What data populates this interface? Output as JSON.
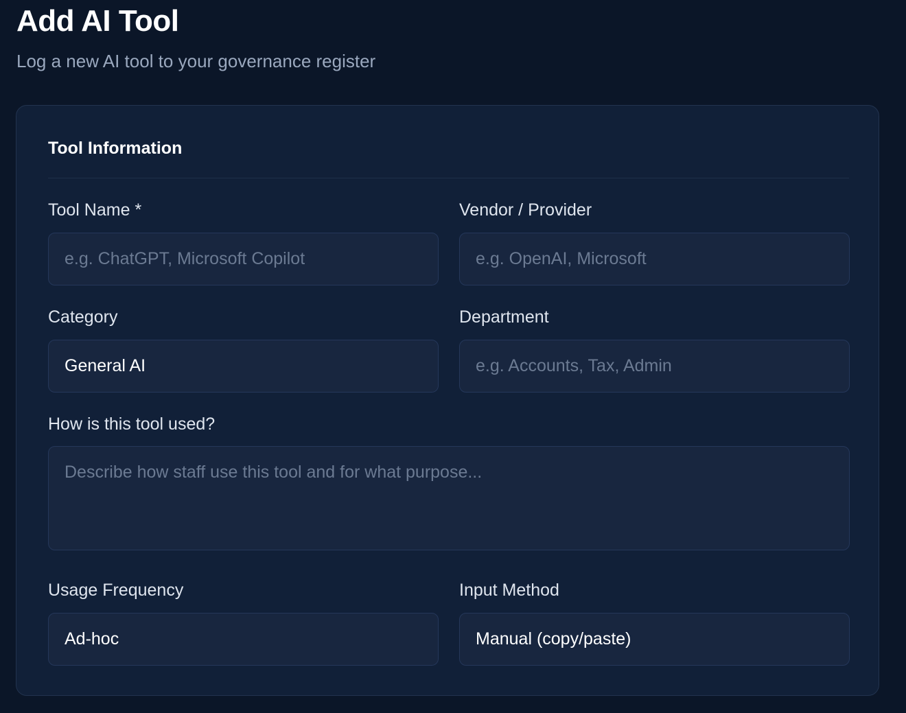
{
  "page": {
    "title": "Add AI Tool",
    "subtitle": "Log a new AI tool to your governance register"
  },
  "form": {
    "section_title": "Tool Information",
    "tool_name": {
      "label": "Tool Name *",
      "value": "",
      "placeholder": "e.g. ChatGPT, Microsoft Copilot"
    },
    "vendor": {
      "label": "Vendor / Provider",
      "value": "",
      "placeholder": "e.g. OpenAI, Microsoft"
    },
    "category": {
      "label": "Category",
      "value": "General AI"
    },
    "department": {
      "label": "Department",
      "value": "",
      "placeholder": "e.g. Accounts, Tax, Admin"
    },
    "usage_description": {
      "label": "How is this tool used?",
      "value": "",
      "placeholder": "Describe how staff use this tool and for what purpose..."
    },
    "usage_frequency": {
      "label": "Usage Frequency",
      "value": "Ad-hoc"
    },
    "input_method": {
      "label": "Input Method",
      "value": "Manual (copy/paste)"
    }
  }
}
